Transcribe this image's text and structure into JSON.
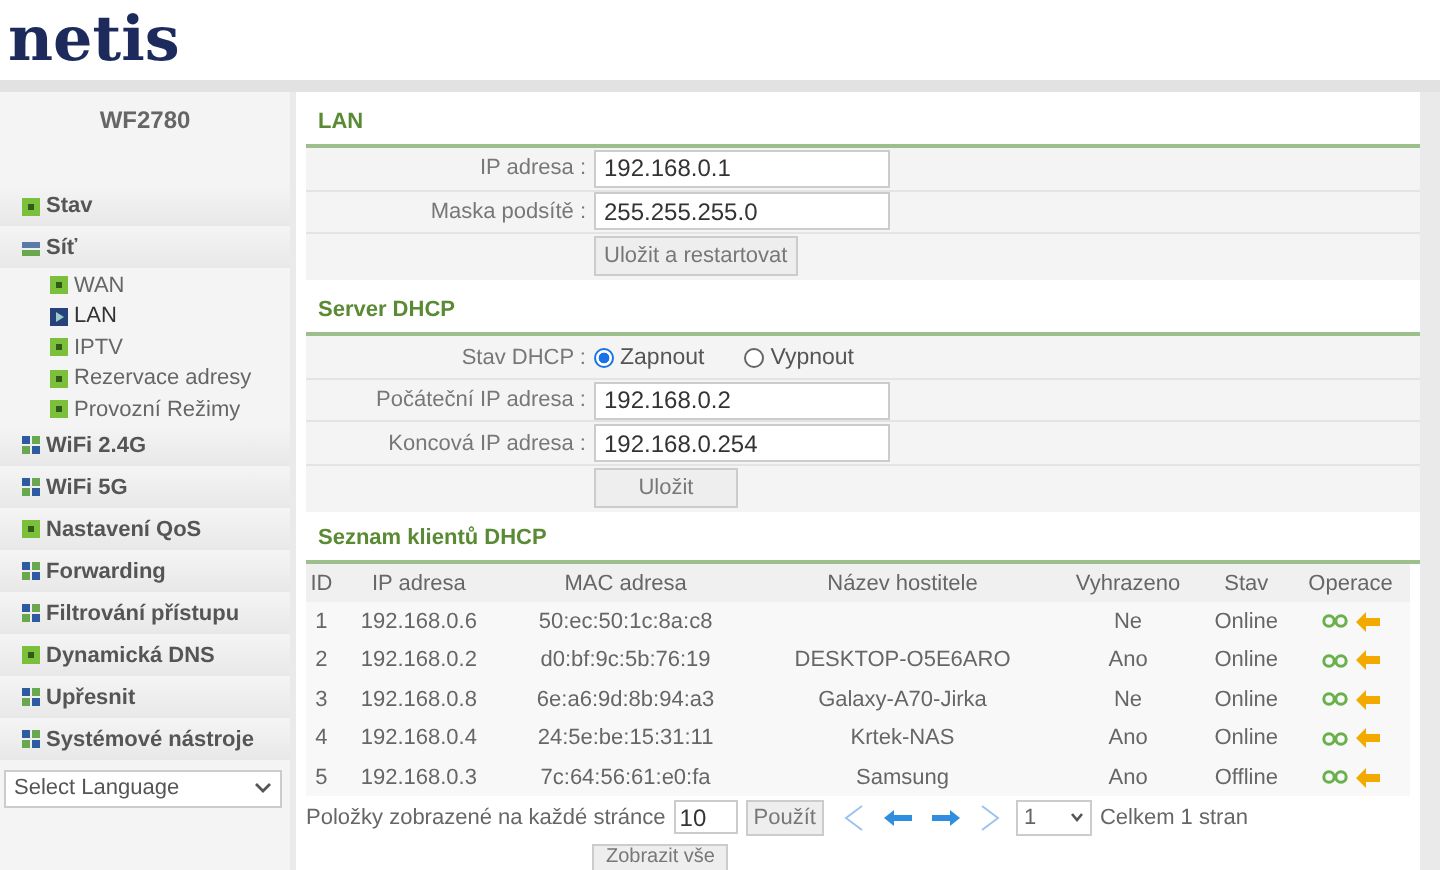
{
  "logo": "netis",
  "sidebar": {
    "model": "WF2780",
    "items": [
      {
        "label": "Stav",
        "kind": "single",
        "expanded": false
      },
      {
        "label": "Síť",
        "kind": "single",
        "expanded": true,
        "children": [
          {
            "label": "WAN",
            "selected": false
          },
          {
            "label": "LAN",
            "selected": true
          },
          {
            "label": "IPTV",
            "selected": false
          },
          {
            "label": "Rezervace adresy",
            "selected": false
          },
          {
            "label": "Provozní Režimy",
            "selected": false
          }
        ]
      },
      {
        "label": "WiFi 2.4G",
        "kind": "group",
        "expanded": false
      },
      {
        "label": "WiFi 5G",
        "kind": "group",
        "expanded": false
      },
      {
        "label": "Nastavení QoS",
        "kind": "single",
        "expanded": false
      },
      {
        "label": "Forwarding",
        "kind": "group",
        "expanded": false
      },
      {
        "label": "Filtrování přístupu",
        "kind": "group",
        "expanded": false
      },
      {
        "label": "Dynamická DNS",
        "kind": "single",
        "expanded": false
      },
      {
        "label": "Upřesnit",
        "kind": "group",
        "expanded": false
      },
      {
        "label": "Systémové nástroje",
        "kind": "group",
        "expanded": false
      }
    ],
    "language": "Select Language"
  },
  "lan": {
    "title": "LAN",
    "fields": [
      {
        "label": "IP adresa :",
        "value": "192.168.0.1"
      },
      {
        "label": "Maska podsítě :",
        "value": "255.255.255.0"
      }
    ],
    "button": "Uložit a restartovat"
  },
  "dhcp": {
    "title": "Server DHCP",
    "status_label": "Stav DHCP :",
    "options": [
      {
        "label": "Zapnout",
        "selected": true
      },
      {
        "label": "Vypnout",
        "selected": false
      }
    ],
    "fields": [
      {
        "label": "Počáteční IP adresa :",
        "value": "192.168.0.2"
      },
      {
        "label": "Koncová IP adresa :",
        "value": "192.168.0.254"
      }
    ],
    "button": "Uložit"
  },
  "clients": {
    "title": "Seznam klientů DHCP",
    "columns": [
      "ID",
      "IP adresa",
      "MAC adresa",
      "Název hostitele",
      "Vyhrazeno",
      "Stav",
      "Operace"
    ],
    "rows": [
      [
        "1",
        "192.168.0.6",
        "50:ec:50:1c:8a:c8",
        "",
        "Ne",
        "Online"
      ],
      [
        "2",
        "192.168.0.2",
        "d0:bf:9c:5b:76:19",
        "DESKTOP-O5E6ARO",
        "Ano",
        "Online"
      ],
      [
        "3",
        "192.168.0.8",
        "6e:a6:9d:8b:94:a3",
        "Galaxy-A70-Jirka",
        "Ne",
        "Online"
      ],
      [
        "4",
        "192.168.0.4",
        "24:5e:be:15:31:11",
        "Krtek-NAS",
        "Ano",
        "Online"
      ],
      [
        "5",
        "192.168.0.3",
        "7c:64:56:61:e0:fa",
        "Samsung",
        "Ano",
        "Offline"
      ]
    ],
    "per_page_label": "Položky zobrazené na každé stránce",
    "per_page": "10",
    "apply": "Použít",
    "page": "1",
    "total": "Celkem 1 stran",
    "show_all": "Zobrazit vše"
  }
}
